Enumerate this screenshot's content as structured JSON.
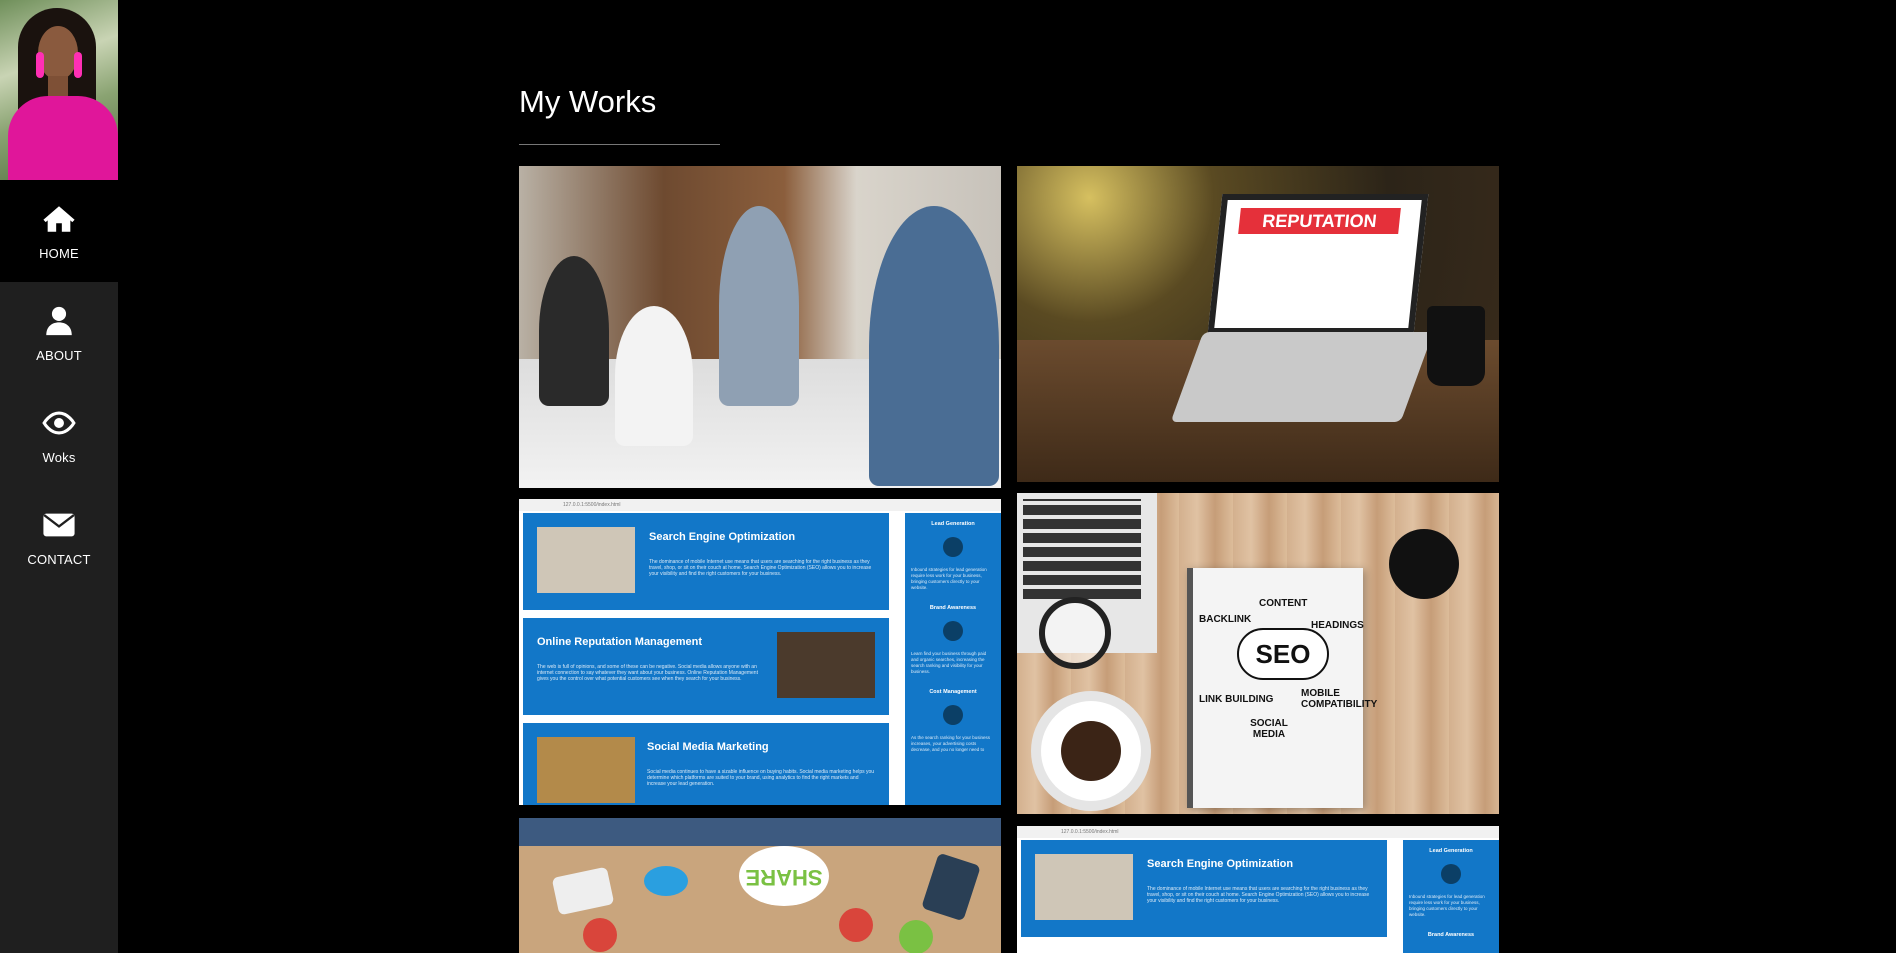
{
  "sidebar": {
    "avatar_alt": "profile photo",
    "items": [
      {
        "label": "HOME",
        "icon": "home-icon",
        "active": true
      },
      {
        "label": "ABOUT",
        "icon": "user-icon",
        "active": false
      },
      {
        "label": "Woks",
        "icon": "eye-icon",
        "active": false
      },
      {
        "label": "CONTACT",
        "icon": "envelope-icon",
        "active": false
      }
    ]
  },
  "main": {
    "title": "My Works"
  },
  "works": {
    "reputation_banner": "REPUTATION",
    "notebook_words": {
      "center": "SEO",
      "content": "CONTENT",
      "backlink": "BACKLINK",
      "headings": "HEADINGS",
      "link_building": "LINK BUILDING",
      "mobile": "MOBILE COMPATIBILITY",
      "social": "SOCIAL MEDIA"
    },
    "share_bubble": "SHARE",
    "site": {
      "url": "127.0.0.1:5500/index.html",
      "sections": [
        {
          "title": "Search Engine Optimization",
          "text": "The dominance of mobile Internet use means that users are searching for the right business as they travel, shop, or sit on their couch at home. Search Engine Optimization (SEO) allows you to increase your visibility and find the right customers for your business."
        },
        {
          "title": "Online Reputation Management",
          "text": "The web is full of opinions, and some of these can be negative. Social media allows anyone with an internet connection to say whatever they want about your business. Online Reputation Management gives you the control over what potential customers see when they search for your business."
        },
        {
          "title": "Social Media Marketing",
          "text": "Social media continues to have a sizable influence on buying habits. Social media marketing helps you determine which platforms are suited to your brand, using analytics to find the right markets and increase your lead generation."
        }
      ],
      "right": [
        {
          "heading": "Lead Generation",
          "text": "Inbound strategies for lead generation require less work for your business, bringing customers directly to your website."
        },
        {
          "heading": "Brand Awareness",
          "text": "Learn find your business through paid and organic searches, increasing the search ranking and visibility for your business."
        },
        {
          "heading": "Cost Management",
          "text": "As the search ranking for your business increases, your advertising costs decrease, and you no longer need to"
        }
      ]
    }
  },
  "colors": {
    "page_bg": "#000000",
    "sidebar_bg": "#1f1f1f",
    "site_blue": "#1277c8"
  }
}
